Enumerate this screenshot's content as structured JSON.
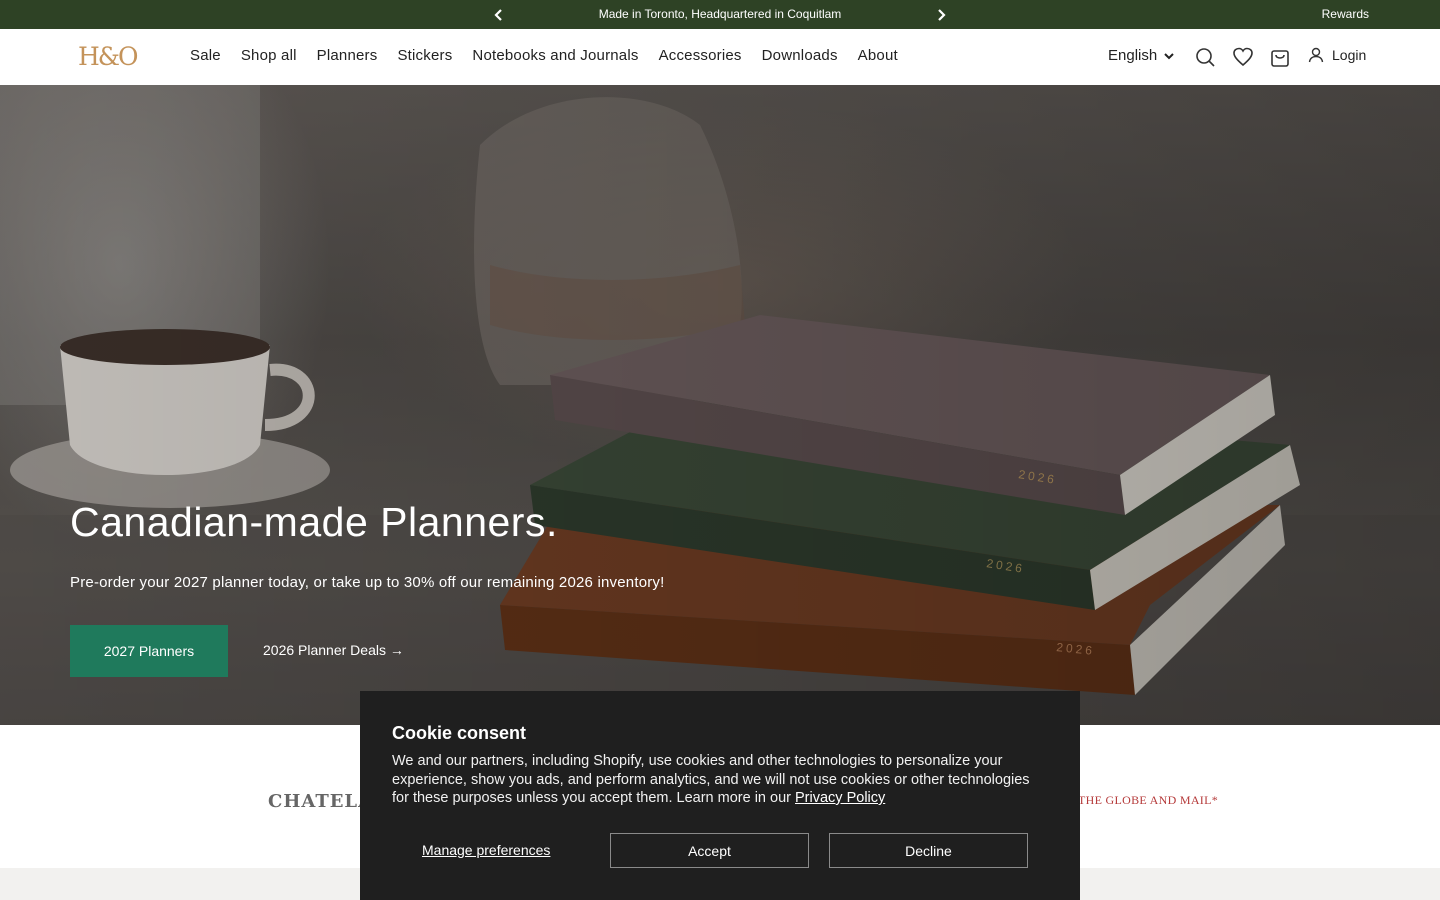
{
  "announcement": {
    "message": "Made in Toronto, Headquartered in Coquitlam",
    "rewards": "Rewards",
    "prev_icon": "chevron-left-icon",
    "next_icon": "chevron-right-icon",
    "background": "#2e4225"
  },
  "header": {
    "logo": "H&O",
    "nav": [
      "Sale",
      "Shop all",
      "Planners",
      "Stickers",
      "Notebooks and Journals",
      "Accessories",
      "Downloads",
      "About"
    ],
    "language": "English",
    "login": "Login",
    "icons": [
      "search-icon",
      "heart-icon",
      "cart-icon",
      "user-icon"
    ]
  },
  "hero": {
    "title": "Canadian-made Planners.",
    "subtitle": "Pre-order your 2027 planner today, or take up to 30% off our remaining 2026 inventory!",
    "primary_button": "2027 Planners",
    "secondary_link": "2026 Planner Deals →",
    "primary_color": "#1f7a5c",
    "book_label": "2026"
  },
  "press": {
    "left_logo": "CHATELAINE",
    "right_logo": "THE GLOBE AND MAIL*"
  },
  "cookie": {
    "title": "Cookie consent",
    "body": "We and our partners, including Shopify, use cookies and other technologies to personalize your experience, show you ads, and perform analytics, and we will not use cookies or other technologies for these purposes unless you accept them. Learn more in our",
    "privacy_link": "Privacy Policy",
    "manage": "Manage preferences",
    "accept": "Accept",
    "decline": "Decline"
  }
}
